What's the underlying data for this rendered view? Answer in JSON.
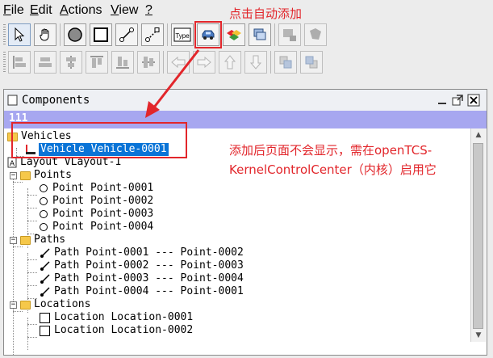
{
  "menu": [
    {
      "mnemonic": "F",
      "rest": "ile"
    },
    {
      "mnemonic": "E",
      "rest": "dit"
    },
    {
      "mnemonic": "A",
      "rest": "ctions"
    },
    {
      "mnemonic": "V",
      "rest": "iew"
    },
    {
      "mnemonic": "?",
      "rest": ""
    }
  ],
  "annotations": {
    "top": "点击自动添加",
    "middle_line1": "添加后页面不会显示，需在openTCS-",
    "middle_line2": "KernelControlCenter（内核）启用它"
  },
  "colors": {
    "accent_red": "#e2262b",
    "selection_blue": "#0a74d7",
    "group_bar": "#a7a7f0"
  },
  "toolbar1": [
    {
      "icon": "select-arrow-icon"
    },
    {
      "icon": "hand-pan-icon"
    },
    {
      "icon": "circle-point-icon"
    },
    {
      "icon": "square-location-icon"
    },
    {
      "icon": "path-line-icon"
    },
    {
      "icon": "path-dotted-icon"
    },
    {
      "icon": "location-type-icon",
      "label": "Type"
    },
    {
      "icon": "vehicle-icon"
    },
    {
      "icon": "blocks-icon"
    },
    {
      "icon": "layers-icon"
    },
    {
      "icon": "add-group-icon"
    },
    {
      "icon": "group-icon"
    }
  ],
  "toolbar2": [
    {
      "icon": "align-left-icon"
    },
    {
      "icon": "align-center-h-icon"
    },
    {
      "icon": "align-right-icon"
    },
    {
      "icon": "align-top-icon"
    },
    {
      "icon": "align-bottom-icon"
    },
    {
      "icon": "align-middle-v-icon"
    },
    {
      "icon": "move-left-icon"
    },
    {
      "icon": "move-right-icon"
    },
    {
      "icon": "move-up-icon"
    },
    {
      "icon": "move-down-icon"
    },
    {
      "icon": "bring-front-icon"
    },
    {
      "icon": "send-back-icon"
    }
  ],
  "panel": {
    "title": "Components",
    "group_bar_label": "111"
  },
  "tree": {
    "vehicles_label": "Vehicles",
    "vehicle_item": "Vehicle Vehicle-0001",
    "layout_label": "Layout VLayout-1",
    "points_label": "Points",
    "points": [
      "Point Point-0001",
      "Point Point-0002",
      "Point Point-0003",
      "Point Point-0004"
    ],
    "paths_label": "Paths",
    "paths": [
      "Path Point-0001 --- Point-0002",
      "Path Point-0002 --- Point-0003",
      "Path Point-0003 --- Point-0004",
      "Path Point-0004 --- Point-0001"
    ],
    "locations_label": "Locations",
    "locations": [
      "Location Location-0001",
      "Location Location-0002"
    ]
  }
}
